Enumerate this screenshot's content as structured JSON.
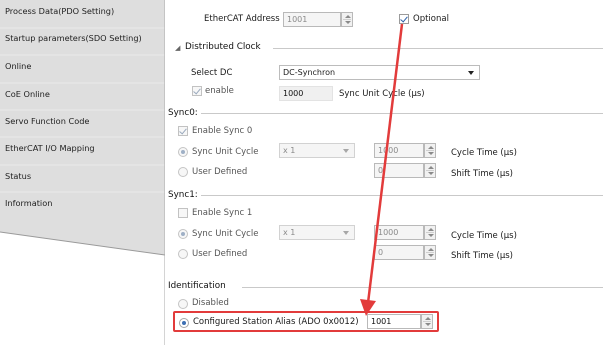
{
  "nav": {
    "items": [
      "Process Data(PDO Setting)",
      "Startup parameters(SDO Setting)",
      "Online",
      "CoE Online",
      "Servo Function Code",
      "EtherCAT I/O Mapping",
      "Status",
      "Information"
    ]
  },
  "top": {
    "ethercat_address_label": "EtherCAT Address",
    "ethercat_address_value": "1001",
    "optional_label": "Optional",
    "optional_checked": true
  },
  "distributed_clock": {
    "title": "Distributed Clock",
    "select_dc_label": "Select DC",
    "select_dc_value": "DC-Synchron",
    "enable_label": "enable",
    "enable_checked": true,
    "sync_unit_cycle_value": "1000",
    "sync_unit_cycle_label": "Sync Unit Cycle (μs)"
  },
  "sync0": {
    "title": "Sync0:",
    "enable_label": "Enable Sync 0",
    "enable_checked": true,
    "sync_unit_cycle_label": "Sync Unit Cycle",
    "multiplier": "x 1",
    "cycle_value": "1000",
    "cycle_time_label": "Cycle Time (μs)",
    "user_defined_label": "User Defined",
    "shift_value": "0",
    "shift_time_label": "Shift Time (μs)"
  },
  "sync1": {
    "title": "Sync1:",
    "enable_label": "Enable Sync 1",
    "enable_checked": false,
    "sync_unit_cycle_label": "Sync Unit Cycle",
    "multiplier": "x 1",
    "cycle_value": "1000",
    "cycle_time_label": "Cycle Time (μs)",
    "user_defined_label": "User Defined",
    "shift_value": "0",
    "shift_time_label": "Shift Time (μs)"
  },
  "identification": {
    "title": "Identification",
    "disabled_label": "Disabled",
    "alias_label": "Configured Station Alias (ADO 0x0012)",
    "alias_value": "1001"
  },
  "colors": {
    "highlight": "#e23b3b",
    "accent": "#3d6fb3"
  }
}
